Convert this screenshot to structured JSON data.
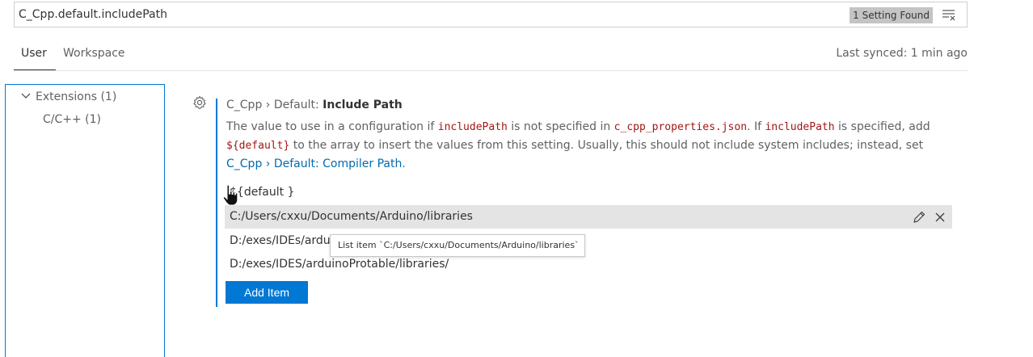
{
  "search": {
    "query": "C_Cpp.default.includePath",
    "result_badge": "1 Setting Found",
    "clear_icon": "clear-filter-icon"
  },
  "tabs": [
    {
      "label": "User",
      "active": true
    },
    {
      "label": "Workspace",
      "active": false
    }
  ],
  "sync_status": "Last synced: 1 min ago",
  "toc": {
    "group_label": "Extensions (1)",
    "child_label": "C/C++ (1)"
  },
  "setting": {
    "category": "C_Cpp › Default: ",
    "name": "Include Path",
    "description": {
      "p1": "The value to use in a configuration if ",
      "c1": "includePath",
      "p2": " is not specified in ",
      "c2": "c_cpp_properties.json",
      "p3": ". If ",
      "c3": "includePath",
      "p4": " is specified, add ",
      "c4": "${default}",
      "p5": " to the array to insert the values from this setting. Usually, this should not include system includes; instead, set ",
      "link": "C_Cpp › Default: Compiler Path",
      "p6": "."
    },
    "default_value": "${default }",
    "items": [
      "C:/Users/cxxu/Documents/Arduino/libraries",
      "D:/exes/IDEs/ardu",
      "D:/exes/IDES/arduinoProtable/libraries/"
    ],
    "add_button": "Add Item"
  },
  "tooltip": "List item `C:/Users/cxxu/Documents/Arduino/libraries`",
  "colors": {
    "accent": "#0078d4",
    "selection": "#e4e4e4",
    "code": "#a31515",
    "link": "#006ab1"
  }
}
